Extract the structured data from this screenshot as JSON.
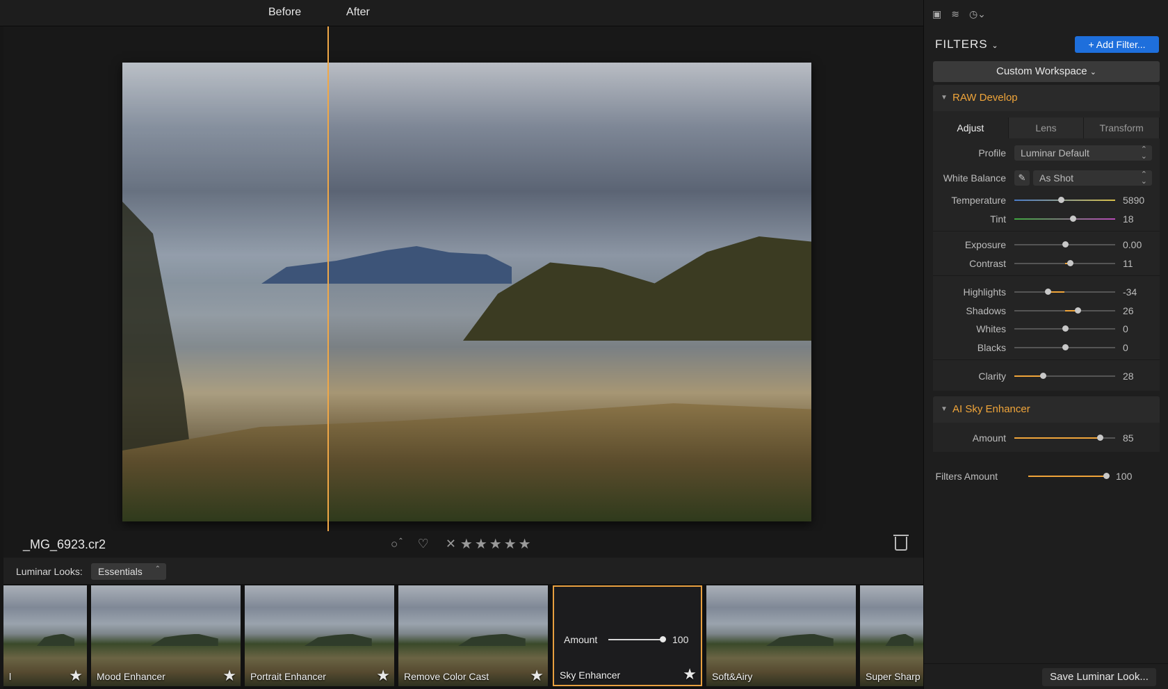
{
  "compare": {
    "before": "Before",
    "after": "After"
  },
  "file": {
    "name": "_MG_6923.cr2"
  },
  "rating": {
    "stars": "★★★★★",
    "reject": "✕"
  },
  "looks": {
    "label": "Luminar Looks:",
    "category": "Essentials",
    "items": [
      {
        "label": "l",
        "starred": true
      },
      {
        "label": "Mood Enhancer",
        "starred": true
      },
      {
        "label": "Portrait Enhancer",
        "starred": true
      },
      {
        "label": "Remove Color Cast",
        "starred": true
      },
      {
        "label": "Sky Enhancer",
        "starred": true,
        "selected": true,
        "amount_label": "Amount",
        "amount_value": "100"
      },
      {
        "label": "Soft&Airy",
        "starred": false
      },
      {
        "label": "Super Sharp",
        "starred": false
      }
    ]
  },
  "panel": {
    "title": "FILTERS",
    "add_filter": "+ Add Filter...",
    "workspace": "Custom Workspace",
    "raw": {
      "title": "RAW Develop",
      "tabs": [
        "Adjust",
        "Lens",
        "Transform"
      ],
      "active_tab": "Adjust",
      "profile_label": "Profile",
      "profile_value": "Luminar Default",
      "wb_label": "White Balance",
      "wb_value": "As Shot",
      "sliders": [
        {
          "label": "Temperature",
          "value": "5890",
          "position": 0.46
        },
        {
          "label": "Tint",
          "value": "18",
          "position": 0.58
        },
        {
          "label": "Exposure",
          "value": "0.00",
          "position": 0.5
        },
        {
          "label": "Contrast",
          "value": "11",
          "position": 0.555
        },
        {
          "label": "Highlights",
          "value": "-34",
          "position": 0.33
        },
        {
          "label": "Shadows",
          "value": "26",
          "position": 0.63
        },
        {
          "label": "Whites",
          "value": "0",
          "position": 0.5
        },
        {
          "label": "Blacks",
          "value": "0",
          "position": 0.5
        },
        {
          "label": "Clarity",
          "value": "28",
          "position": 0.28
        }
      ]
    },
    "sky": {
      "title": "AI Sky Enhancer",
      "amount_label": "Amount",
      "amount_value": "85",
      "amount_position": 0.85
    },
    "filters_amount_label": "Filters Amount",
    "filters_amount_value": "100",
    "filters_amount_position": 1.0,
    "save_look": "Save Luminar Look..."
  },
  "colors": {
    "accent": "#f0a53a",
    "button_blue": "#1e6fdc",
    "split_line": "#f0a848"
  }
}
